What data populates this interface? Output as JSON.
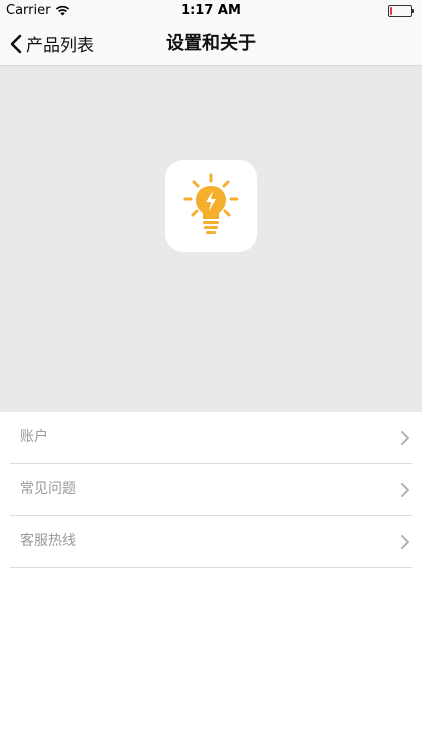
{
  "status_bar": {
    "carrier": "Carrier",
    "time": "1:17 AM",
    "battery_level": 0.1
  },
  "nav": {
    "back_label": "产品列表",
    "title": "设置和关于"
  },
  "app_icon": {
    "icon": "lightbulb-icon",
    "color": "#F6AE2D"
  },
  "menu": {
    "items": [
      {
        "label": "账户"
      },
      {
        "label": "常见问题"
      },
      {
        "label": "客服热线"
      }
    ]
  },
  "colors": {
    "hero_background": "#E9E9E9",
    "label_gray": "#9A9A9A",
    "battery_low": "#E53935"
  }
}
